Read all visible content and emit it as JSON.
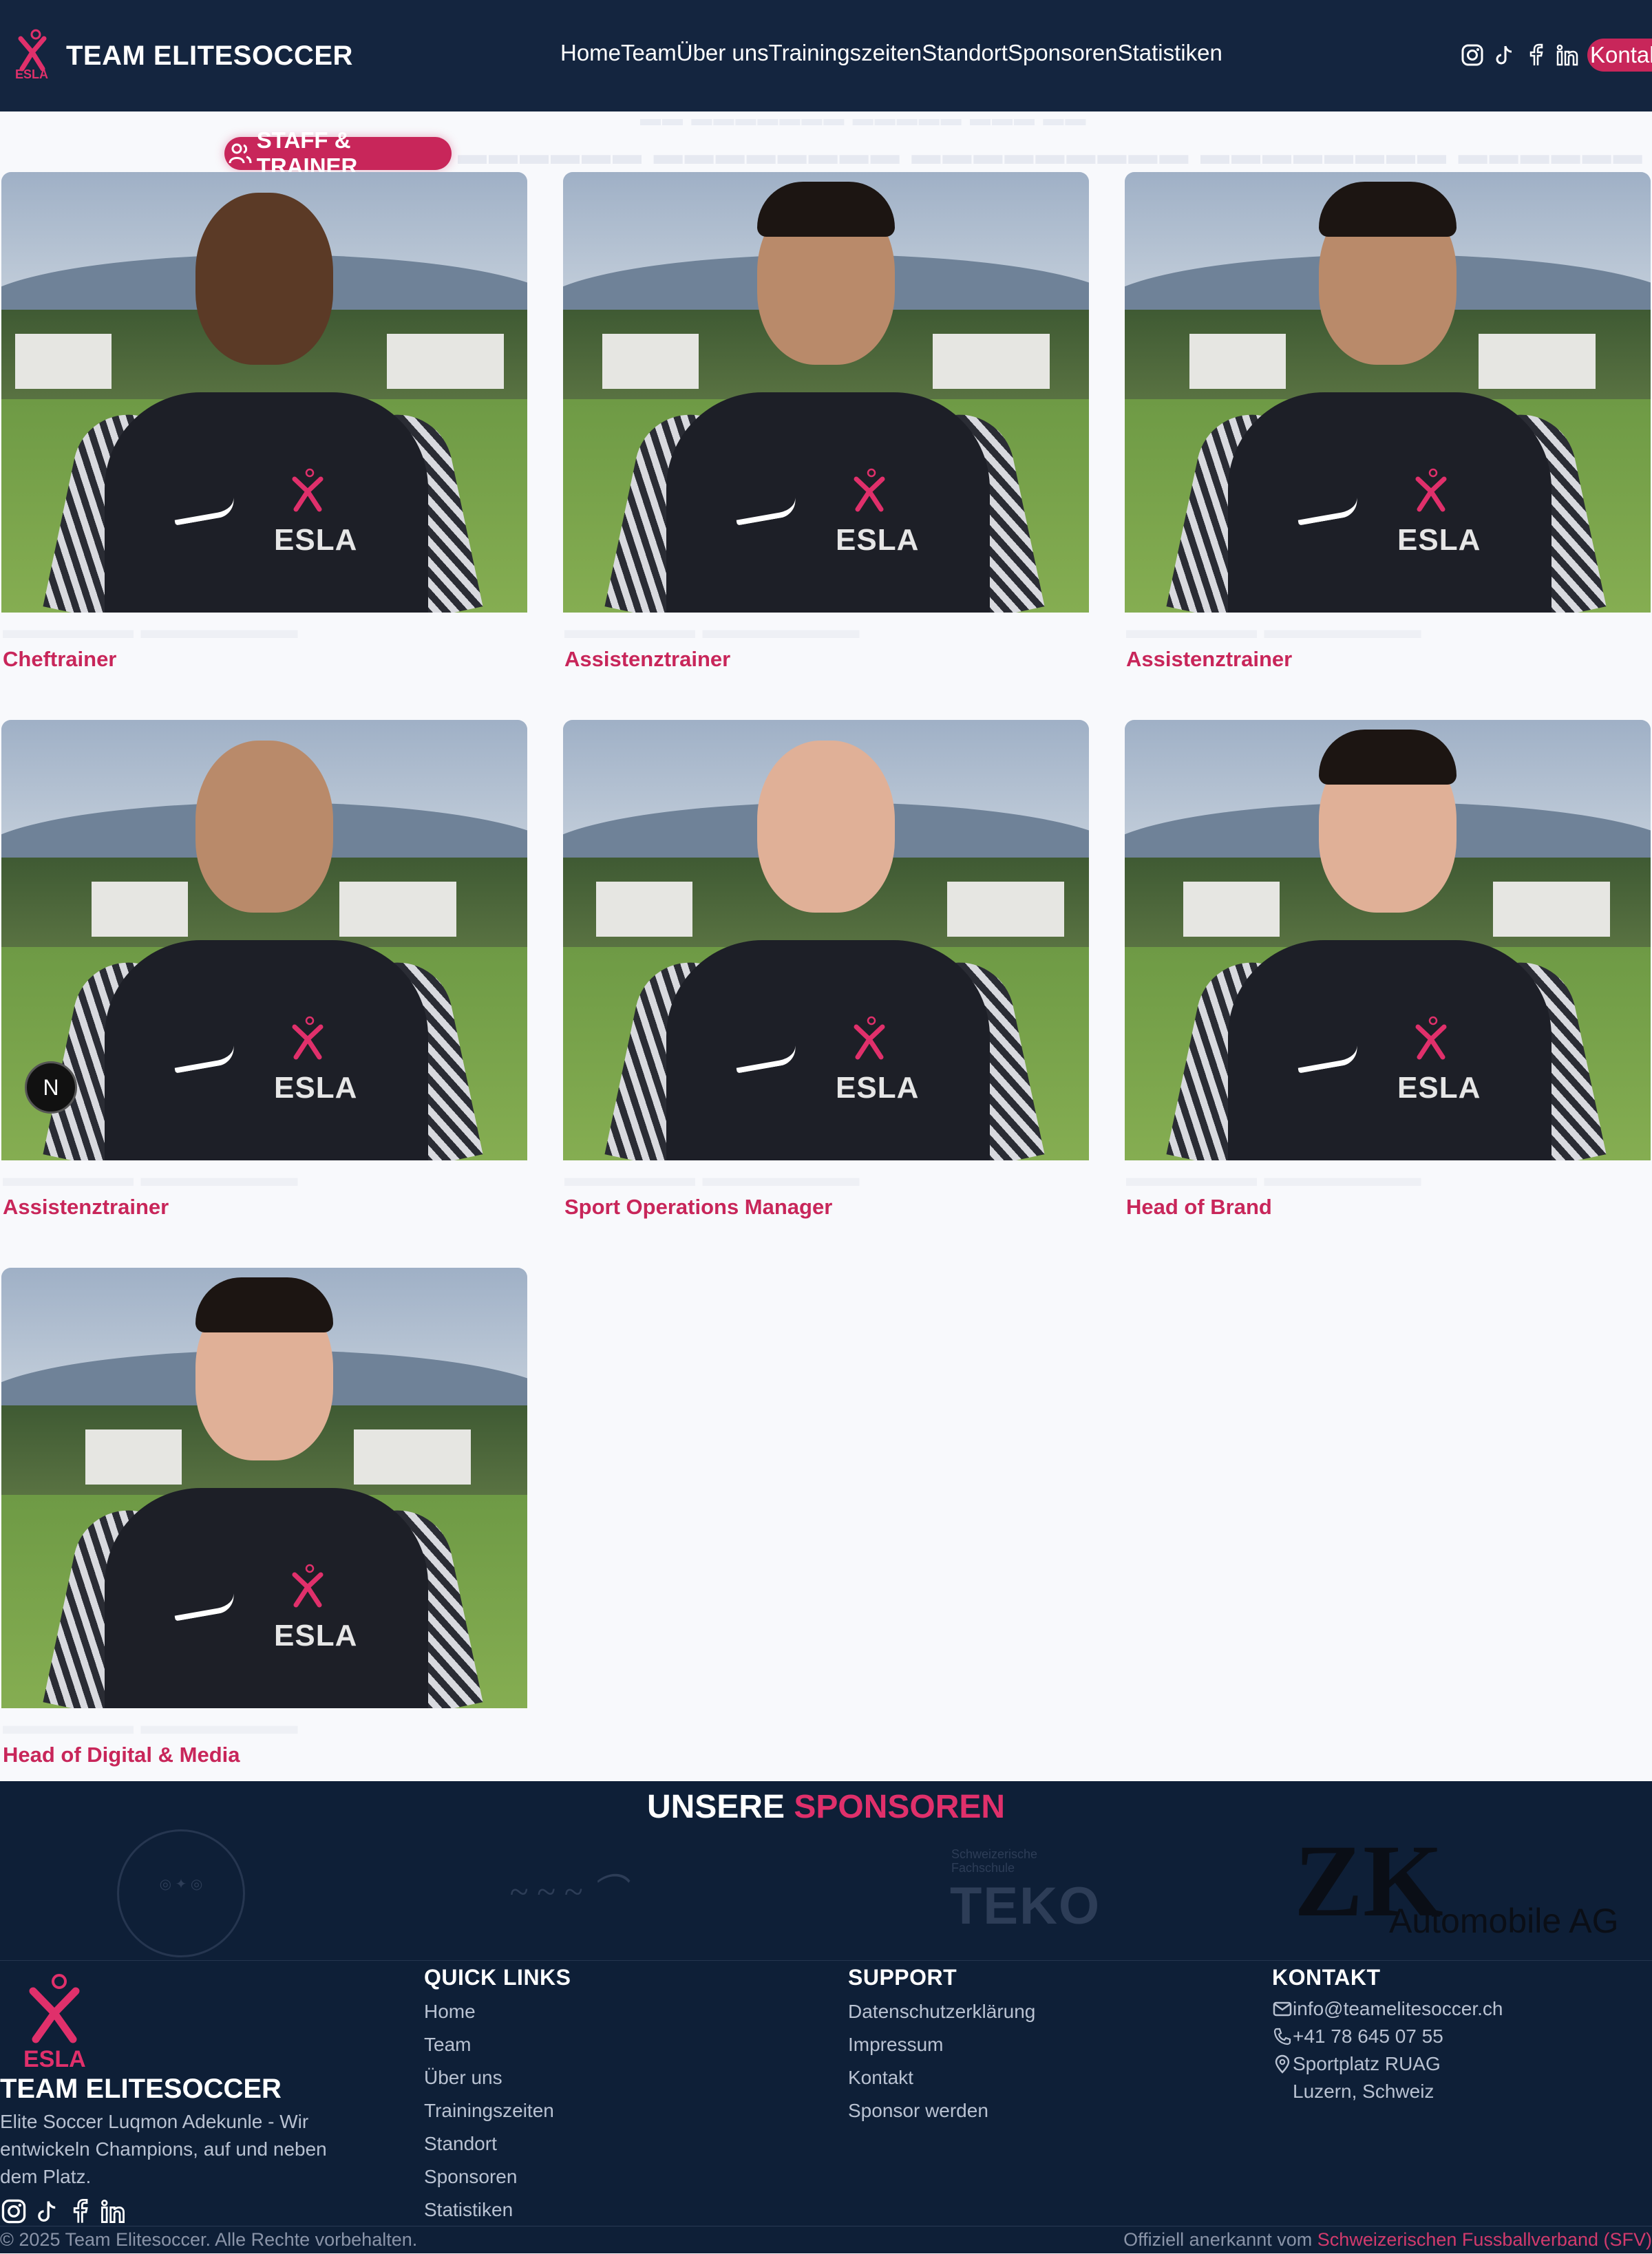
{
  "header": {
    "brand_name": "TEAM ELITESOCCER",
    "logo_text": "ESLA",
    "nav": [
      "Home",
      "Team",
      "Über uns",
      "Trainingszeiten",
      "Standort",
      "Sponsoren",
      "Statistiken"
    ],
    "social_icons": [
      "instagram-icon",
      "tiktok-icon",
      "facebook-icon",
      "linkedin-icon"
    ],
    "contact_button": "Kontakt"
  },
  "filter": {
    "active_label": "STAFF & TRAINER",
    "icon": "users-icon"
  },
  "staff": [
    {
      "role": "Cheftrainer"
    },
    {
      "role": "Assistenztrainer"
    },
    {
      "role": "Assistenztrainer"
    },
    {
      "role": "Assistenztrainer"
    },
    {
      "role": "Sport Operations Manager"
    },
    {
      "role": "Head of Brand"
    },
    {
      "role": "Head of Digital & Media"
    }
  ],
  "jersey_text": "ESLA",
  "badge_text": "N",
  "sponsors": {
    "title_white": "UNSERE",
    "title_pink": "SPONSOREN",
    "teko_small": "Schweizerische Fachschule",
    "teko": "TEKO",
    "zk_letter": "ZK",
    "zk": "Automobile AG"
  },
  "footer": {
    "brand_name": "TEAM ELITESOCCER",
    "logo_text": "ESLA",
    "description": "Elite Soccer Luqmon Adekunle - Wir entwickeln Champions, auf und neben dem Platz.",
    "quick_links_title": "QUICK LINKS",
    "quick_links": [
      "Home",
      "Team",
      "Über uns",
      "Trainingszeiten",
      "Standort",
      "Sponsoren",
      "Statistiken"
    ],
    "support_title": "SUPPORT",
    "support_links": [
      "Datenschutzerklärung",
      "Impressum",
      "Kontakt",
      "Sponsor werden"
    ],
    "contact_title": "KONTAKT",
    "email": "info@teamelitesoccer.ch",
    "phone": "+41 78 645 07 55",
    "address_line1": "Sportplatz RUAG",
    "address_line2": "Luzern, Schweiz",
    "copyright": "© 2025 Team Elitesoccer. Alle Rechte vorbehalten.",
    "official_prefix": "Offiziell anerkannt vom",
    "official_link": "Schweizerischen Fussballverband (SFV)"
  },
  "colors": {
    "navy": "#14253f",
    "footer_navy": "#0e1f37",
    "accent_pink": "#c8265a"
  }
}
